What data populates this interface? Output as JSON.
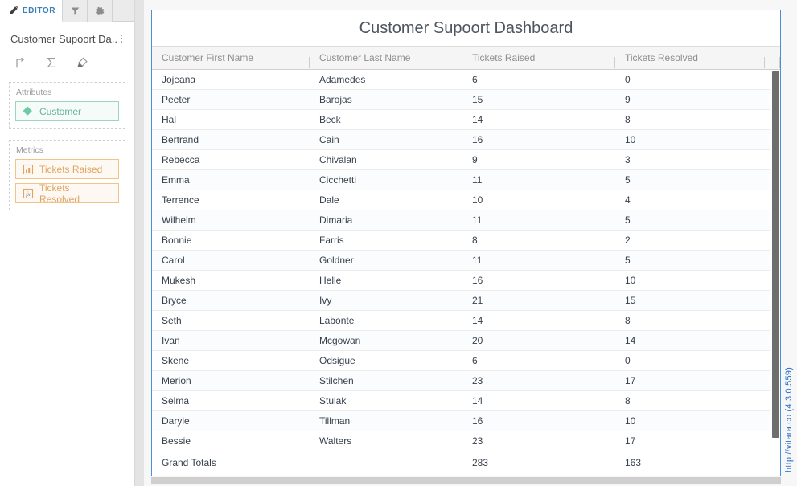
{
  "sidebar": {
    "tabs": [
      {
        "label": "EDITOR",
        "icon": "pencil-icon",
        "active": true
      },
      {
        "label": "",
        "icon": "filter-icon",
        "active": false
      },
      {
        "label": "",
        "icon": "gear-icon",
        "active": false
      }
    ],
    "panel_title": "Customer Supoort Da...",
    "kebab_label": "more-options",
    "tools": [
      {
        "name": "pivot-icon",
        "tooltip": "Pivot"
      },
      {
        "name": "sigma-totals-icon",
        "tooltip": "Totals"
      },
      {
        "name": "eraser-icon",
        "tooltip": "Clear"
      }
    ],
    "shelves": [
      {
        "label": "Attributes",
        "chips": [
          {
            "label": "Customer",
            "icon": "diamond-attribute-icon",
            "kind": "attr"
          }
        ]
      },
      {
        "label": "Metrics",
        "chips": [
          {
            "label": "Tickets Raised",
            "icon": "metric-bar-icon",
            "kind": "metric"
          },
          {
            "label": "Tickets Resolved",
            "icon": "fx-formula-icon",
            "kind": "metric"
          }
        ]
      }
    ]
  },
  "dashboard": {
    "title": "Customer Supoort Dashboard",
    "watermark": "http://vitara.co (4.3.0.559)"
  },
  "chart_data": {
    "type": "table",
    "title": "Customer Supoort Dashboard",
    "columns": [
      "Customer First Name",
      "Customer Last Name",
      "Tickets Raised",
      "Tickets Resolved",
      ""
    ],
    "rows": [
      [
        "Jojeana",
        "Adamedes",
        "6",
        "0"
      ],
      [
        "Peeter",
        "Barojas",
        "15",
        "9"
      ],
      [
        "Hal",
        "Beck",
        "14",
        "8"
      ],
      [
        "Bertrand",
        "Cain",
        "16",
        "10"
      ],
      [
        "Rebecca",
        "Chivalan",
        "9",
        "3"
      ],
      [
        "Emma",
        "Cicchetti",
        "11",
        "5"
      ],
      [
        "Terrence",
        "Dale",
        "10",
        "4"
      ],
      [
        "Wilhelm",
        "Dimaria",
        "11",
        "5"
      ],
      [
        "Bonnie",
        "Farris",
        "8",
        "2"
      ],
      [
        "Carol",
        "Goldner",
        "11",
        "5"
      ],
      [
        "Mukesh",
        "Helle",
        "16",
        "10"
      ],
      [
        "Bryce",
        "Ivy",
        "21",
        "15"
      ],
      [
        "Seth",
        "Labonte",
        "14",
        "8"
      ],
      [
        "Ivan",
        "Mcgowan",
        "20",
        "14"
      ],
      [
        "Skene",
        "Odsigue",
        "6",
        "0"
      ],
      [
        "Merion",
        "Stilchen",
        "23",
        "17"
      ],
      [
        "Selma",
        "Stulak",
        "14",
        "8"
      ],
      [
        "Daryle",
        "Tillman",
        "16",
        "10"
      ],
      [
        "Bessie",
        "Walters",
        "23",
        "17"
      ]
    ],
    "totals_label": "Grand Totals",
    "totals": [
      "",
      "283",
      "163"
    ]
  },
  "colors": {
    "accent_blue": "#4a90d9",
    "tab_active_text": "#3a7fb5",
    "attribute_green": "#67b497",
    "metric_orange": "#e0a463",
    "link_blue": "#2a6fc9",
    "scrollbar_thumb": "#6e6e6e"
  }
}
